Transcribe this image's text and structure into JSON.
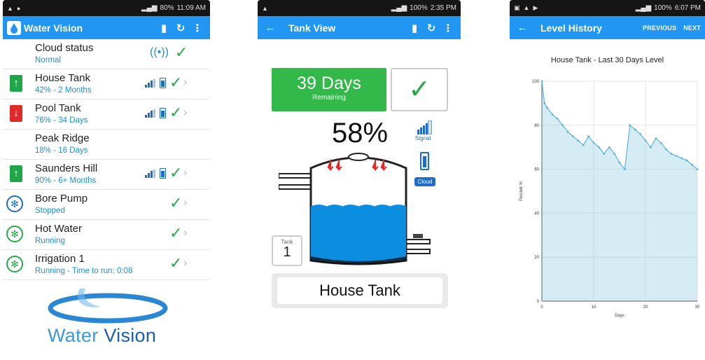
{
  "screen1": {
    "status_time": "11:09 AM",
    "status_battery": "80%",
    "title": "Water Vision",
    "actions": [
      "doc-icon",
      "refresh-icon",
      "menu-icon"
    ],
    "items": [
      {
        "name": "Cloud status",
        "status": "Normal",
        "icon": "",
        "type": "cloud"
      },
      {
        "name": "House Tank",
        "status": "42% - 2 Months",
        "icon": "up-arrow-icon",
        "color": "#1fa64a",
        "type": "tank"
      },
      {
        "name": "Pool Tank",
        "status": "76% - 34 Days",
        "icon": "down-arrow-icon",
        "color": "#e02a2a",
        "type": "tank"
      },
      {
        "name": "Peak Ridge",
        "status": "18% - 16 Days",
        "icon": "",
        "type": "tank"
      },
      {
        "name": "Saunders Hill",
        "status": "90% - 6+ Months",
        "icon": "up-arrow-icon",
        "color": "#1fa64a",
        "type": "tank"
      },
      {
        "name": "Bore Pump",
        "status": "Stopped",
        "icon": "fan-icon",
        "color": "#1e6cc8",
        "type": "pump"
      },
      {
        "name": "Hot Water",
        "status": "Running",
        "icon": "fan-icon",
        "color": "#27a94a",
        "type": "pump"
      },
      {
        "name": "Irrigation 1",
        "status": "Running - Time to run: 0:08",
        "icon": "fan-icon",
        "color": "#27a94a",
        "type": "pump"
      }
    ],
    "logo": {
      "part1": "Water",
      "part2": "Vision"
    }
  },
  "screen2": {
    "status_time": "2:35 PM",
    "status_battery": "100%",
    "title": "Tank View",
    "days_value": "39 Days",
    "days_label": "Remaining",
    "percent": "58%",
    "fill_level": 0.58,
    "signal_label": "Signal",
    "cloud_label": "Cloud",
    "tank_label": "Tank",
    "tank_number": "1",
    "tank_name": "House Tank"
  },
  "screen3": {
    "status_time": "6:07 PM",
    "status_battery": "100%",
    "title": "Level History",
    "previous_label": "PREVIOUS",
    "next_label": "NEXT"
  },
  "chart_data": {
    "type": "area",
    "title": "House Tank - Last 30 Days Level",
    "xlabel": "Days",
    "ylabel": "Percent %",
    "xlim": [
      0,
      30
    ],
    "ylim": [
      0,
      100
    ],
    "xticks": [
      0,
      10,
      20,
      30
    ],
    "yticks": [
      0,
      20,
      40,
      60,
      80,
      100
    ],
    "grid": true,
    "x": [
      0,
      0.5,
      1,
      2,
      3,
      4,
      5,
      6,
      7,
      8,
      9,
      10,
      11,
      12,
      13,
      14,
      15,
      16,
      17,
      18,
      19,
      20,
      21,
      22,
      23,
      24,
      25,
      26,
      27,
      28,
      29,
      30
    ],
    "y": [
      100,
      90,
      88,
      85,
      83,
      80,
      77,
      75,
      73,
      71,
      75,
      72,
      70,
      67,
      70,
      67,
      63,
      60,
      80,
      78,
      76,
      73,
      70,
      74,
      72,
      69,
      67,
      66,
      65,
      64,
      62,
      60
    ],
    "color": "#5bb3d8"
  }
}
